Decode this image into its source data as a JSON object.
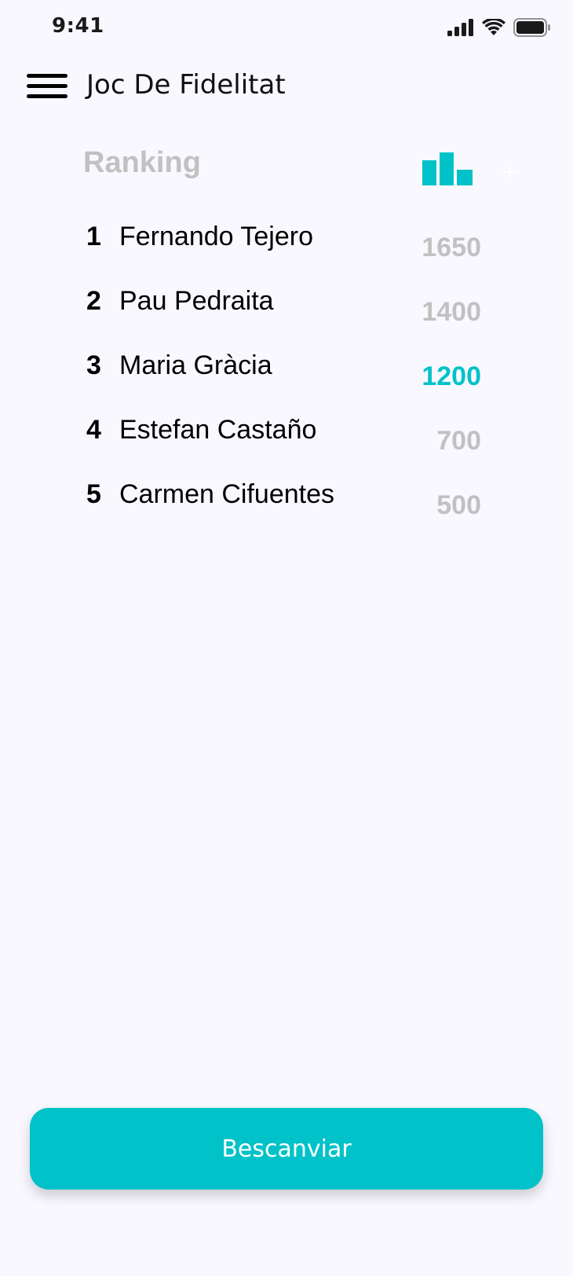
{
  "status_bar": {
    "time": "9:41",
    "icons": [
      "signal-icon",
      "wifi-icon",
      "battery-icon"
    ]
  },
  "header": {
    "title": "Joc De Fidelitat",
    "menu_icon": "hamburger-menu-icon"
  },
  "ranking": {
    "title": "Ranking",
    "chart_icon": "bar-chart-icon",
    "add_icon": "plus-icon",
    "accent_color": "#00C2C8",
    "muted_color": "#C1C1C1",
    "entries": [
      {
        "position": "1",
        "name": "Fernando Tejero",
        "score": "1650",
        "highlight": false
      },
      {
        "position": "2",
        "name": "Pau Pedraita",
        "score": "1400",
        "highlight": false
      },
      {
        "position": "3",
        "name": "Maria Gràcia",
        "score": "1200",
        "highlight": true
      },
      {
        "position": "4",
        "name": "Estefan Castaño",
        "score": "700",
        "highlight": false
      },
      {
        "position": "5",
        "name": "Carmen Cifuentes",
        "score": "500",
        "highlight": false
      }
    ]
  },
  "actions": {
    "redeem_label": "Bescanviar"
  }
}
